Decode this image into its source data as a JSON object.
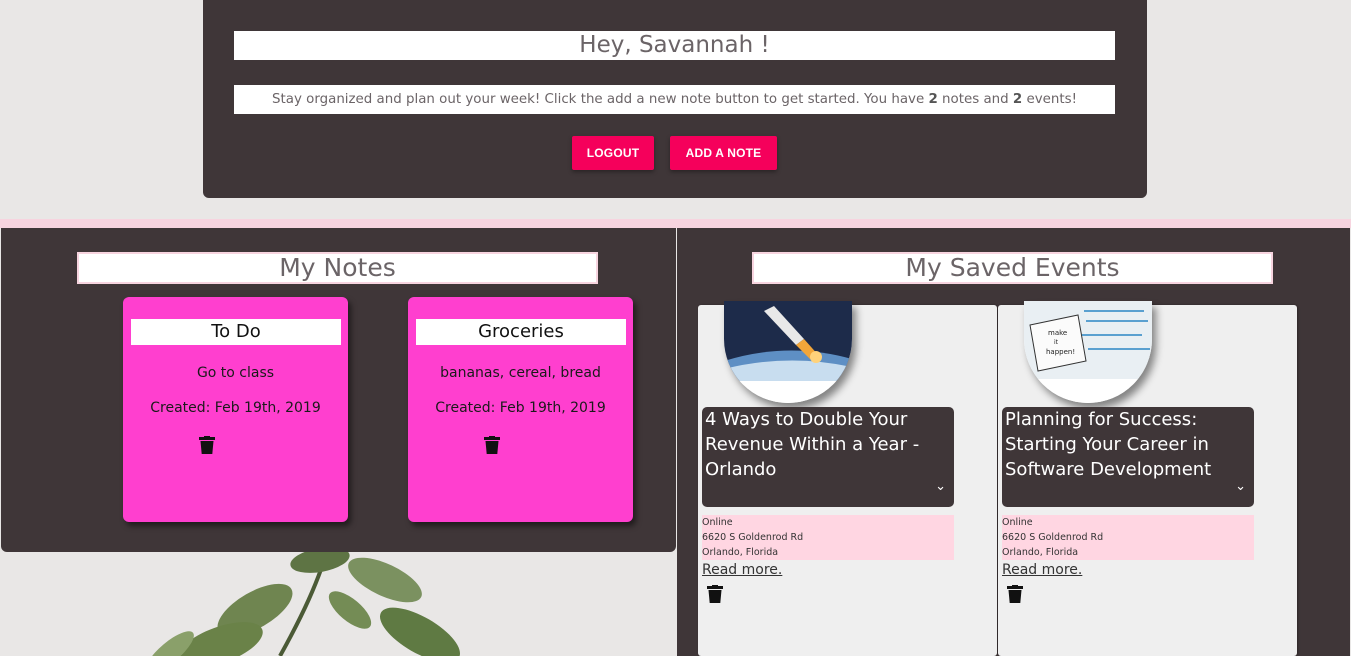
{
  "header": {
    "greeting": "Hey, Savannah !",
    "intro": {
      "before": "Stay organized and plan out your week! Click the add a new note button to get started. You have ",
      "notes_count": "2",
      "middle": " notes and ",
      "events_count": "2",
      "after": " events!"
    },
    "logout_label": "LOGOUT",
    "add_note_label": "ADD A NOTE"
  },
  "notes": {
    "title": "My Notes",
    "items": [
      {
        "title": "To Do",
        "body": "Go to class",
        "created": "Created: Feb 19th, 2019"
      },
      {
        "title": "Groceries",
        "body": "bananas, cereal, bread",
        "created": "Created: Feb 19th, 2019"
      }
    ]
  },
  "events": {
    "title": "My Saved Events",
    "items": [
      {
        "title": "4 Ways to Double Your Revenue Within a Year - Orlando",
        "loc1": "Online",
        "loc2": "6620 S Goldenrod Rd",
        "loc3": "Orlando, Florida",
        "more": "Read more.",
        "image": "rocket-launch-image"
      },
      {
        "title": "Planning for Success: Starting Your Career in Software Development",
        "loc1": "Online",
        "loc2": "6620 S Goldenrod Rd",
        "loc3": "Orlando, Florida",
        "more": "Read more.",
        "image": "notebook-make-it-happen-image"
      }
    ]
  },
  "colors": {
    "accent": "#f5005b",
    "panel": "#3f3638",
    "note": "#ff3fcf",
    "soft_pink": "#f7d4df"
  }
}
